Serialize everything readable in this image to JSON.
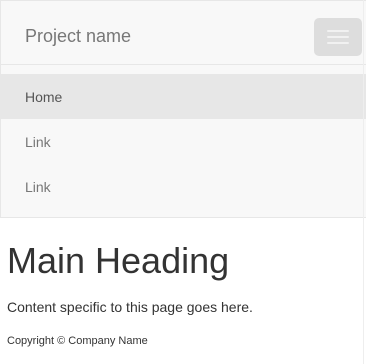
{
  "navbar": {
    "brand": "Project name",
    "items": [
      {
        "label": "Home"
      },
      {
        "label": "Link"
      },
      {
        "label": "Link"
      }
    ]
  },
  "main": {
    "heading": "Main Heading",
    "content": "Content specific to this page goes here."
  },
  "footer": {
    "copyright": "Copyright © Company Name"
  },
  "colors": {
    "navbar_bg": "#f8f8f8",
    "navbar_border": "#e7e7e7",
    "active_bg": "#e7e7e7",
    "toggle_bg": "#dddddd",
    "nav_text": "#777777",
    "body_text": "#333333"
  },
  "icons": {
    "toggle": "hamburger-icon"
  }
}
